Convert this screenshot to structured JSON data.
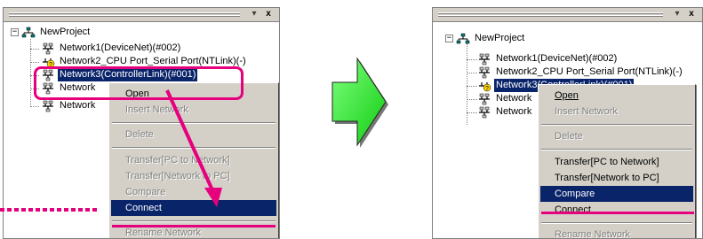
{
  "left_panel": {
    "title_buttons": {
      "dropdown": "▾",
      "close": "x"
    },
    "tree": {
      "root": "NewProject",
      "expander": "−",
      "items": [
        "Network1(DeviceNet)(#002)",
        "Network2_CPU Port_Serial Port(NTLink)(-)",
        "Network3(ControllerLink)(#001)",
        "Network",
        "Network"
      ]
    },
    "menu": [
      {
        "label": "Open"
      },
      {
        "label": "Insert Network"
      },
      {
        "label": "Delete"
      },
      {
        "label": "Transfer[PC to Network]"
      },
      {
        "label": "Transfer[Network to PC]"
      },
      {
        "label": "Compare"
      },
      {
        "label": "Connect"
      },
      {
        "label": "Rename Network"
      }
    ]
  },
  "right_panel": {
    "title_buttons": {
      "dropdown": "▾",
      "close": "x"
    },
    "tree": {
      "root": "NewProject",
      "expander": "−",
      "items": [
        "Network1(DeviceNet)(#002)",
        "Network2_CPU Port_Serial Port(NTLink)(-)",
        "Network3(ControllerLink)(#001)",
        "Network",
        "Network"
      ]
    },
    "menu": [
      {
        "label": "Open"
      },
      {
        "label": "Insert Network"
      },
      {
        "label": "Delete"
      },
      {
        "label": "Transfer[PC to Network]"
      },
      {
        "label": "Transfer[Network to PC]"
      },
      {
        "label": "Compare"
      },
      {
        "label": "Connect"
      },
      {
        "label": "Rename Network"
      }
    ]
  },
  "colors": {
    "callout": "#e6007e",
    "arrow_fill": "#22ee22",
    "selection": "#0a246a",
    "menu_bg": "#d4d0c8"
  }
}
